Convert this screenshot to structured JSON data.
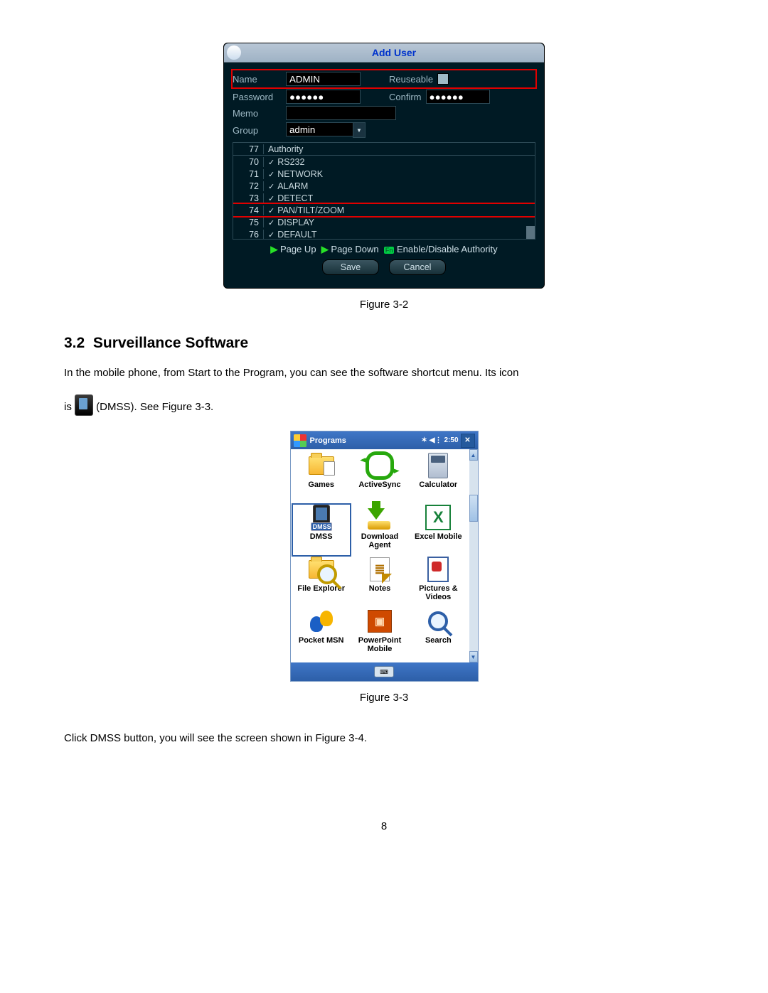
{
  "fig32": {
    "title": "Add User",
    "fields": {
      "name_label": "Name",
      "name_value": "ADMIN",
      "reuse_label": "Reuseable",
      "pwd_label": "Password",
      "pwd_value": "●●●●●●",
      "confirm_label": "Confirm",
      "confirm_value": "●●●●●●",
      "memo_label": "Memo",
      "group_label": "Group",
      "group_value": "admin"
    },
    "authority_header": {
      "num": "77",
      "label": "Authority"
    },
    "authorities": [
      {
        "n": "70",
        "name": "RS232"
      },
      {
        "n": "71",
        "name": "NETWORK"
      },
      {
        "n": "72",
        "name": "ALARM"
      },
      {
        "n": "73",
        "name": "DETECT"
      },
      {
        "n": "74",
        "name": "PAN/TILT/ZOOM",
        "hl": true
      },
      {
        "n": "75",
        "name": "DISPLAY"
      },
      {
        "n": "76",
        "name": "DEFAULT"
      }
    ],
    "nav": {
      "pageup": "Page Up",
      "pagedown": "Page Down",
      "enable": "Enable/Disable Authority"
    },
    "save": "Save",
    "cancel": "Cancel",
    "caption": "Figure 3-2"
  },
  "section": {
    "num": "3.2",
    "title": "Surveillance Software"
  },
  "para1_a": "In the mobile phone, from Start to the Program, you can see the software shortcut menu. Its icon",
  "para1_b": "is ",
  "para1_c": " (DMSS). See Figure 3-3.",
  "fig33": {
    "bar_title": "Programs",
    "time": "2:50",
    "apps": [
      {
        "name": "Games",
        "icon": "games"
      },
      {
        "name": "ActiveSync",
        "icon": "sync"
      },
      {
        "name": "Calculator",
        "icon": "calc"
      },
      {
        "name": "DMSS",
        "icon": "dmss",
        "label": "DMSS"
      },
      {
        "name": "Download Agent",
        "icon": "dl"
      },
      {
        "name": "Excel Mobile",
        "icon": "excel"
      },
      {
        "name": "File Explorer",
        "icon": "fileexp"
      },
      {
        "name": "Notes",
        "icon": "notes"
      },
      {
        "name": "Pictures & Videos",
        "icon": "pics"
      },
      {
        "name": "Pocket MSN",
        "icon": "msn"
      },
      {
        "name": "PowerPoint Mobile",
        "icon": "ppt"
      },
      {
        "name": "Search",
        "icon": "search"
      }
    ],
    "caption": "Figure 3-3"
  },
  "para2": "Click DMSS button, you will see the screen shown in Figure 3-4.",
  "page_number": "8"
}
